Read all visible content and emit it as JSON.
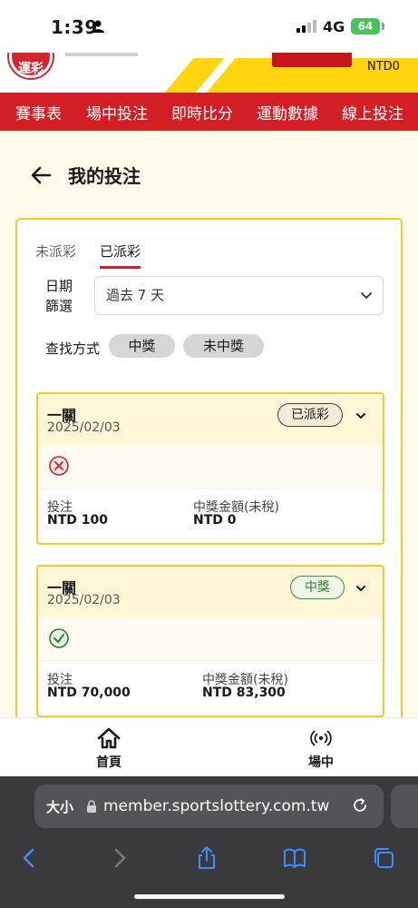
{
  "status_bar": {
    "time": "1:39",
    "network": "4G",
    "battery": "64"
  },
  "header": {
    "logo_text": "運彩",
    "balance": "NTD0"
  },
  "nav": {
    "items": [
      "賽事表",
      "場中投注",
      "即時比分",
      "運動數據",
      "線上投注"
    ]
  },
  "page": {
    "title": "我的投注"
  },
  "tabs": [
    {
      "label": "未派彩",
      "active": false
    },
    {
      "label": "已派彩",
      "active": true
    }
  ],
  "filter": {
    "date_label": "日期篩選",
    "date_value": "過去 7 天",
    "search_label": "查找方式",
    "chips": [
      "中獎",
      "未中獎"
    ]
  },
  "bets": [
    {
      "type": "一關",
      "date": "2025/02/03",
      "status": "已派彩",
      "result": "lost",
      "stake_label": "投注",
      "stake_value": "NTD 100",
      "payout_label": "中獎金額(未稅)",
      "payout_value": "NTD 0"
    },
    {
      "type": "一關",
      "date": "2025/02/03",
      "status": "中獎",
      "result": "won",
      "stake_label": "投注",
      "stake_value": "NTD 70,000",
      "payout_label": "中獎金額(未稅)",
      "payout_value": "NTD 83,300"
    }
  ],
  "bottom_bar": {
    "home_label": "首頁",
    "live_label": "場中"
  },
  "browser": {
    "text_size": "大小",
    "url": "member.sportslottery.com.tw"
  },
  "colors": {
    "brand_red": "#d41e26",
    "brand_yellow": "#f0cd2a",
    "win_green": "#2e7d32",
    "lose_red": "#c62828"
  }
}
